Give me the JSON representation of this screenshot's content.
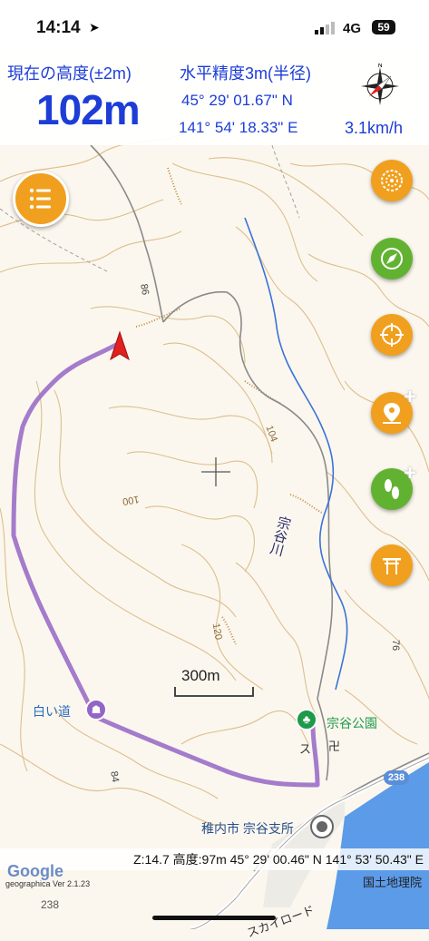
{
  "status_bar": {
    "time": "14:14",
    "location_icon": "location-arrow-icon",
    "network": "4G",
    "battery": "59"
  },
  "header": {
    "altitude_label": "現在の高度(±2m)",
    "altitude_value": "102m",
    "accuracy": "水平精度3m(半径)",
    "latitude": "45° 29' 01.67\" N",
    "longitude": "141° 54' 18.33\" E",
    "speed": "3.1km/h"
  },
  "buttons": {
    "menu_icon": "menu-list-icon",
    "right": [
      {
        "icon": "swirl-icon",
        "color": "#f0a01e"
      },
      {
        "icon": "compass-icon",
        "color": "#62b232"
      },
      {
        "icon": "crosshair-icon",
        "color": "#f0a01e"
      },
      {
        "icon": "add-pin-icon",
        "color": "#f0a01e"
      },
      {
        "icon": "add-footprints-icon",
        "color": "#62b232"
      },
      {
        "icon": "torii-icon",
        "color": "#f0a01e"
      }
    ]
  },
  "map": {
    "scale_label": "300m",
    "contour_labels": [
      "104",
      "100",
      "120",
      "86",
      "84",
      "76"
    ],
    "river_label": "宗谷川",
    "poi": [
      {
        "name": "白い道"
      },
      {
        "name": "宗谷公園"
      },
      {
        "name": "稚内市 宗谷支所"
      }
    ],
    "route_number": "238",
    "road_label_bottom": "238",
    "road_name": "スカイロード",
    "misc_labels": [
      "ス",
      "卍"
    ]
  },
  "footer": {
    "info": "Z:14.7 高度:97m  45° 29' 00.46\" N 141° 53' 50.43\" E",
    "google": "Google",
    "gsi_version": "geographica Ver 2.1.23",
    "gsi": "国土地理院"
  },
  "colors": {
    "accent_blue": "#1d3dd6",
    "orange": "#f0a01e",
    "green": "#62b232",
    "route": "#9466c4",
    "contour": "#c79a55"
  }
}
